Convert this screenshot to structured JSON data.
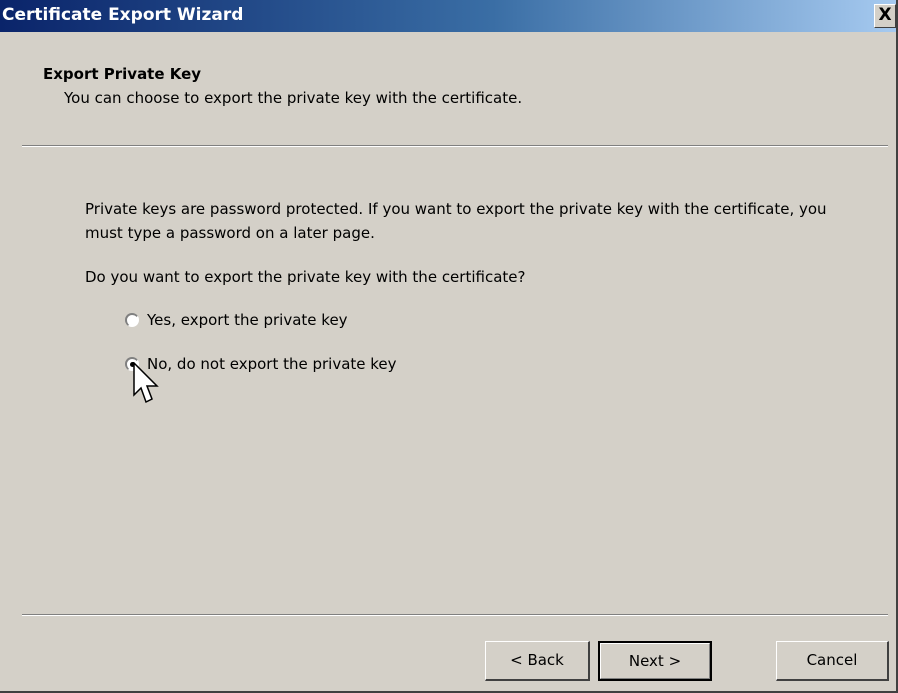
{
  "window": {
    "title": "Certificate Export Wizard",
    "close_label": "X"
  },
  "header": {
    "title": "Export Private Key",
    "subtitle": "You can choose to export the private key with the certificate."
  },
  "content": {
    "description": "Private keys are password protected. If you want to export the private key with the certificate, you must type a password on a later page.",
    "question": "Do you want to export the private key with the certificate?",
    "options": [
      {
        "label": "Yes, export the private key",
        "selected": false
      },
      {
        "label": "No, do not export the private key",
        "selected": true
      }
    ]
  },
  "buttons": {
    "back_label": "< Back",
    "next_label": "Next >",
    "cancel_label": "Cancel"
  },
  "colors": {
    "title_gradient_start": "#0a246a",
    "title_gradient_end": "#a6caf0",
    "dialog_background": "#d4d0c8"
  },
  "icons": {
    "close": "close-icon",
    "cursor": "mouse-pointer-icon"
  }
}
